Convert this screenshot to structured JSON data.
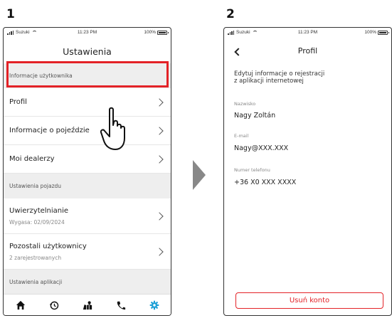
{
  "steps": {
    "one": "1",
    "two": "2"
  },
  "status_bar": {
    "carrier": "Suzuki",
    "time": "11:23 PM",
    "battery": "100%"
  },
  "screen1": {
    "title": "Ustawienia",
    "sections": [
      {
        "header": "Informacje użytkownika"
      },
      {
        "header": "Ustawienia pojazdu"
      },
      {
        "header": "Ustawienia aplikacji"
      }
    ],
    "rows": {
      "profile": "Profil",
      "ride_info": "Informacje o pojeździe",
      "dealers": "Moi dealerzy",
      "auth": "Uwierzytelnianie",
      "auth_sub": "Wygasa: 02/09/2024",
      "other_users": "Pozostali użytkownicy",
      "other_users_sub": "2 zarejestrowanych"
    },
    "tabs": [
      "home-icon",
      "history-icon",
      "map-icon",
      "phone-icon",
      "gear-icon"
    ],
    "accent": "#e32227",
    "active_tab_color": "#1a9fd6"
  },
  "screen2": {
    "title": "Profil",
    "description_line1": "Edytuj informacje o rejestracji",
    "description_line2": "z aplikacji internetowej",
    "fields": [
      {
        "label": "Nazwisko",
        "value": "Nagy Zoltán"
      },
      {
        "label": "E-mail",
        "value": "Nagy@XXX.XXX"
      },
      {
        "label": "Numer telefonu",
        "value": "+36 X0 XXX XXXX"
      }
    ],
    "delete_button": "Usuń konto"
  }
}
